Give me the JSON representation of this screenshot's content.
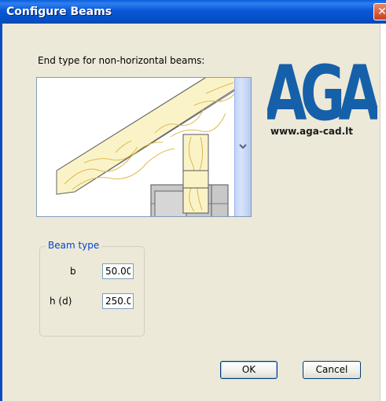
{
  "window": {
    "title": "Configure Beams",
    "close_label": "✕"
  },
  "end_type": {
    "label": "End type for non-horizontal beams:",
    "selected_option_icon": "beam-end-preview"
  },
  "logo": {
    "brand": "AGA",
    "url_text": "www.aga-cad.lt",
    "brand_color": "#1560a8"
  },
  "beam_type": {
    "group_label": "Beam type",
    "b_label": "b",
    "b_value": "50.00",
    "h_label": "h (d)",
    "h_value": "250.00"
  },
  "buttons": {
    "ok_label": "OK",
    "cancel_label": "Cancel"
  }
}
